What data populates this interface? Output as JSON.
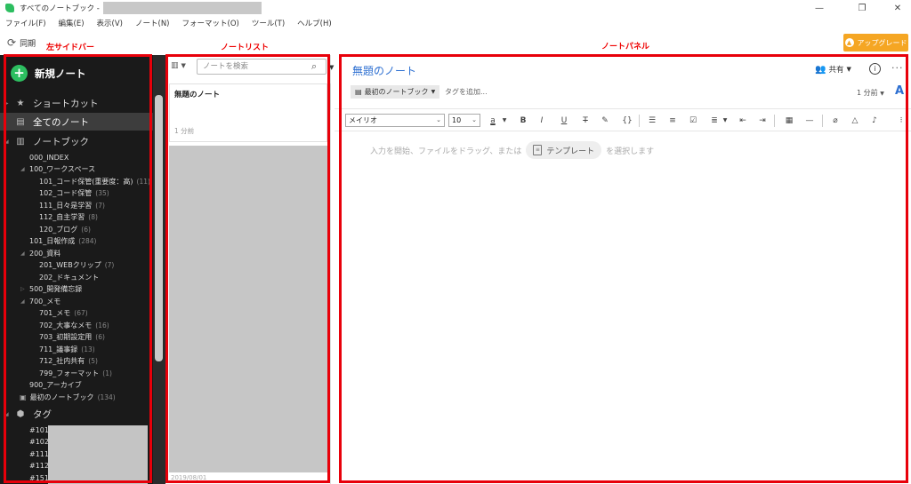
{
  "window": {
    "title": "すべてのノートブック - ",
    "minimize": "—",
    "maximize": "❐",
    "close": "✕"
  },
  "menu": [
    "ファイル(F)",
    "編集(E)",
    "表示(V)",
    "ノート(N)",
    "フォーマット(O)",
    "ツール(T)",
    "ヘルプ(H)"
  ],
  "toolbar": {
    "sync_label": "同期",
    "sync_icon": "sync-icon",
    "upgrade_label": "アップグレード"
  },
  "annotations": {
    "left_sidebar": "左サイドバー",
    "note_list": "ノートリスト",
    "note_panel": "ノートパネル"
  },
  "sidebar": {
    "new_note": "新規ノート",
    "shortcuts": "ショートカット",
    "all_notes": "全てのノート",
    "notebooks": "ノートブック",
    "tags": "タグ",
    "notebook_items": [
      {
        "label": "000_INDEX",
        "count": ""
      },
      {
        "label": "100_ワークスペース",
        "count": ""
      },
      {
        "label": "101_コード保管(重要度：高)",
        "count": "(11)"
      },
      {
        "label": "102_コード保管",
        "count": "(35)"
      },
      {
        "label": "111_日々是学習",
        "count": "(7)"
      },
      {
        "label": "112_自主学習",
        "count": "(8)"
      },
      {
        "label": "120_ブログ",
        "count": "(6)"
      },
      {
        "label": "101_日報作成",
        "count": "(284)"
      },
      {
        "label": "200_資料",
        "count": ""
      },
      {
        "label": "201_WEBクリップ",
        "count": "(7)"
      },
      {
        "label": "202_ドキュメント",
        "count": ""
      },
      {
        "label": "500_開発備忘録",
        "count": ""
      },
      {
        "label": "700_メモ",
        "count": ""
      },
      {
        "label": "701_メモ",
        "count": "(67)"
      },
      {
        "label": "702_大事なメモ",
        "count": "(16)"
      },
      {
        "label": "703_初期設定用",
        "count": "(6)"
      },
      {
        "label": "711_議事録",
        "count": "(13)"
      },
      {
        "label": "712_社内共有",
        "count": "(5)"
      },
      {
        "label": "799_フォーマット",
        "count": "(1)"
      },
      {
        "label": "900_アーカイブ",
        "count": ""
      },
      {
        "label": "最初のノートブック",
        "count": "(134)"
      }
    ],
    "tag_items": [
      "#101_",
      "#102_",
      "#111_",
      "#112_",
      "#151_"
    ]
  },
  "note_list": {
    "search_placeholder": "ノートを検索",
    "notes": [
      {
        "title": "無題のノート",
        "time": "1 分前"
      }
    ],
    "bottom_date": "2019/08/01"
  },
  "note_panel": {
    "title": "無題のノート",
    "share_label": "共有",
    "notebook": "最初のノートブック",
    "add_tag": "タグを追加...",
    "time_meta": "1 分前",
    "font_family": "メイリオ",
    "font_size": "10",
    "placeholder_before": "入力を開始、ファイルをドラッグ、または",
    "template_label": "テンプレート",
    "placeholder_after": "を選択します"
  }
}
